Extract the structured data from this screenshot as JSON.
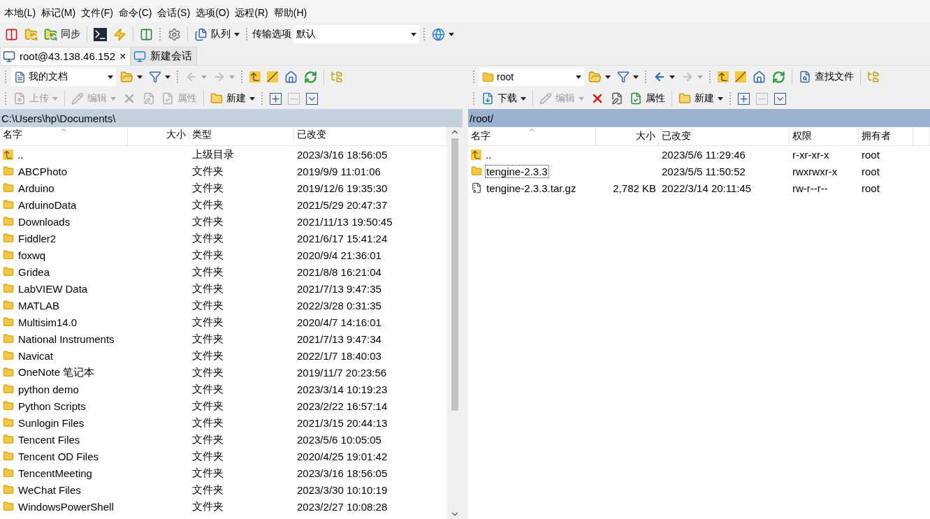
{
  "menu": [
    "本地(L)",
    "标记(M)",
    "文件(F)",
    "命令(C)",
    "会话(S)",
    "选项(O)",
    "远程(R)",
    "帮助(H)"
  ],
  "toolbar": {
    "sync_label": "同步",
    "queue_label": "队列",
    "transfer_label": "传输选项",
    "transfer_value": "默认"
  },
  "tabs": [
    {
      "label": "root@43.138.46.152",
      "selected": true,
      "kind": "session",
      "closable": "×"
    },
    {
      "label": "新建会话",
      "selected": false,
      "kind": "new"
    }
  ],
  "panels": [
    {
      "kind": "local",
      "active": false,
      "location": "我的文档",
      "back": {
        "disabled": true
      },
      "forward": {
        "disabled": true
      },
      "actions": [
        {
          "kind": "upload",
          "label": "上传",
          "disabled": true
        },
        {
          "kind": "edit",
          "label": "编辑",
          "disabled": true
        },
        {
          "kind": "delete",
          "disabled": true
        },
        {
          "kind": "rename",
          "disabled": true
        },
        {
          "kind": "properties",
          "label": "属性",
          "disabled": true
        },
        {
          "kind": "new",
          "label": "新建",
          "disabled": false
        }
      ],
      "path": "C:\\Users\\hp\\Documents\\",
      "columns": [
        {
          "label": "名字",
          "sorted": true
        },
        {
          "label": "大小",
          "sorted": false
        },
        {
          "label": "类型",
          "sorted": false
        },
        {
          "label": "已改变",
          "sorted": false
        }
      ],
      "rows": [
        {
          "kind": "parent",
          "selected": false,
          "cells": [
            "..",
            null,
            "上级目录",
            "2023/3/16 18:56:05"
          ]
        },
        {
          "kind": "folder",
          "selected": false,
          "cells": [
            "ABCPhoto",
            null,
            "文件夹",
            "2019/9/9 11:01:06"
          ]
        },
        {
          "kind": "folder",
          "selected": false,
          "cells": [
            "Arduino",
            null,
            "文件夹",
            "2019/12/6 19:35:30"
          ]
        },
        {
          "kind": "folder",
          "selected": false,
          "cells": [
            "ArduinoData",
            null,
            "文件夹",
            "2021/5/29 20:47:37"
          ]
        },
        {
          "kind": "folder",
          "selected": false,
          "cells": [
            "Downloads",
            null,
            "文件夹",
            "2021/11/13 19:50:45"
          ]
        },
        {
          "kind": "folder",
          "selected": false,
          "cells": [
            "Fiddler2",
            null,
            "文件夹",
            "2021/6/17 15:41:24"
          ]
        },
        {
          "kind": "folder",
          "selected": false,
          "cells": [
            "foxwq",
            null,
            "文件夹",
            "2020/9/4 21:36:01"
          ]
        },
        {
          "kind": "folder",
          "selected": false,
          "cells": [
            "Gridea",
            null,
            "文件夹",
            "2021/8/8 16:21:04"
          ]
        },
        {
          "kind": "folder",
          "selected": false,
          "cells": [
            "LabVIEW Data",
            null,
            "文件夹",
            "2021/7/13 9:47:35"
          ]
        },
        {
          "kind": "folder",
          "selected": false,
          "cells": [
            "MATLAB",
            null,
            "文件夹",
            "2022/3/28 0:31:35"
          ]
        },
        {
          "kind": "folder",
          "selected": false,
          "cells": [
            "Multisim14.0",
            null,
            "文件夹",
            "2020/4/7 14:16:01"
          ]
        },
        {
          "kind": "folder",
          "selected": false,
          "cells": [
            "National Instruments",
            null,
            "文件夹",
            "2021/7/13 9:47:34"
          ]
        },
        {
          "kind": "folder",
          "selected": false,
          "cells": [
            "Navicat",
            null,
            "文件夹",
            "2022/1/7 18:40:03"
          ]
        },
        {
          "kind": "folder",
          "selected": false,
          "cells": [
            "OneNote 笔记本",
            null,
            "文件夹",
            "2019/11/7 20:23:56"
          ]
        },
        {
          "kind": "folder",
          "selected": false,
          "cells": [
            "python demo",
            null,
            "文件夹",
            "2023/3/14 10:19:23"
          ]
        },
        {
          "kind": "folder",
          "selected": false,
          "cells": [
            "Python Scripts",
            null,
            "文件夹",
            "2023/2/22 16:57:14"
          ]
        },
        {
          "kind": "folder",
          "selected": false,
          "cells": [
            "Sunlogin Files",
            null,
            "文件夹",
            "2021/3/15 20:44:13"
          ]
        },
        {
          "kind": "folder",
          "selected": false,
          "cells": [
            "Tencent Files",
            null,
            "文件夹",
            "2023/5/6 10:05:05"
          ]
        },
        {
          "kind": "folder",
          "selected": false,
          "cells": [
            "Tencent OD Files",
            null,
            "文件夹",
            "2020/4/25 19:01:42"
          ]
        },
        {
          "kind": "folder",
          "selected": false,
          "cells": [
            "TencentMeeting",
            null,
            "文件夹",
            "2023/3/16 18:56:05"
          ]
        },
        {
          "kind": "folder",
          "selected": false,
          "cells": [
            "WeChat Files",
            null,
            "文件夹",
            "2023/3/30 10:10:19"
          ]
        },
        {
          "kind": "folder",
          "selected": false,
          "cells": [
            "WindowsPowerShell",
            null,
            "文件夹",
            "2023/2/27 10:08:28"
          ]
        }
      ]
    },
    {
      "kind": "remote",
      "active": true,
      "location": "root",
      "find_label": "查找文件",
      "back": {
        "disabled": false
      },
      "forward": {
        "disabled": true
      },
      "actions": [
        {
          "kind": "download",
          "label": "下载",
          "disabled": false
        },
        {
          "kind": "edit",
          "label": "编辑",
          "disabled": true
        },
        {
          "kind": "delete",
          "disabled": false
        },
        {
          "kind": "rename",
          "disabled": false
        },
        {
          "kind": "properties",
          "label": "属性",
          "disabled": false
        },
        {
          "kind": "new",
          "label": "新建",
          "disabled": false
        }
      ],
      "path": "/root/",
      "columns": [
        {
          "label": "名字",
          "sorted": true
        },
        {
          "label": "大小",
          "sorted": false
        },
        {
          "label": "已改变",
          "sorted": false
        },
        {
          "label": "权限",
          "sorted": false
        },
        {
          "label": "拥有者",
          "sorted": false
        }
      ],
      "rows": [
        {
          "kind": "parent",
          "selected": false,
          "cells": [
            "..",
            null,
            "2023/5/6 11:29:46",
            "r-xr-xr-x",
            "root"
          ]
        },
        {
          "kind": "folder",
          "selected": true,
          "cells": [
            "tengine-2.3.3",
            null,
            "2023/5/5 11:50:52",
            "rwxrwxr-x",
            "root"
          ]
        },
        {
          "kind": "archive",
          "selected": false,
          "cells": [
            "tengine-2.3.3.tar.gz",
            "2,782 KB",
            "2022/3/14 20:11:45",
            "rw-r--r--",
            "root"
          ]
        }
      ]
    }
  ]
}
